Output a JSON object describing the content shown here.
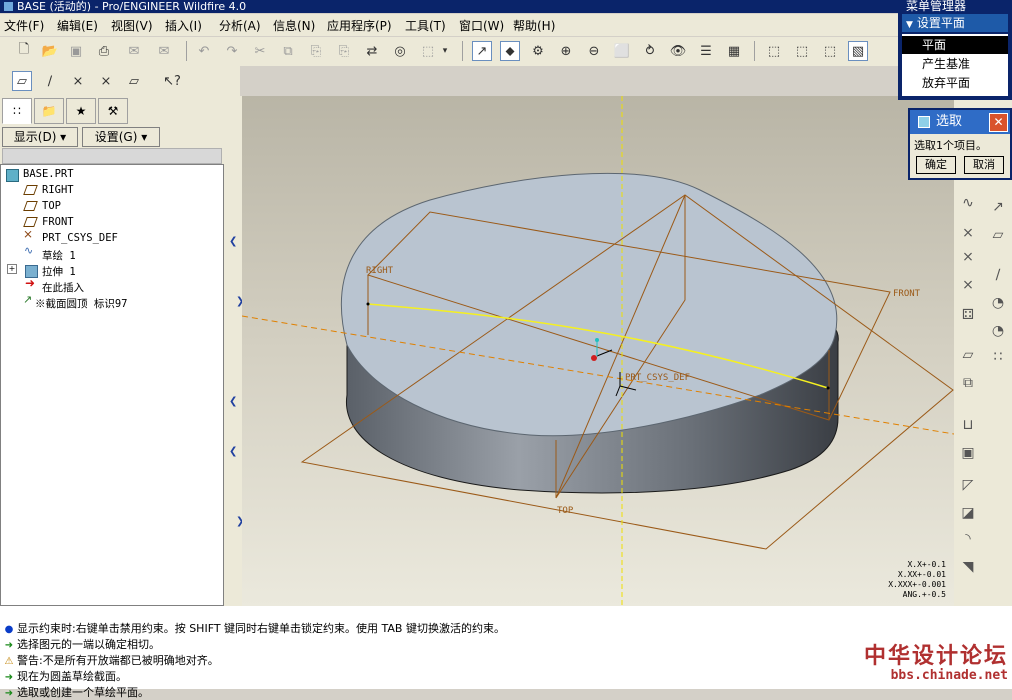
{
  "app": {
    "title": "BASE (活动的) - Pro/ENGINEER Wildfire 4.0"
  },
  "menubar": [
    "文件(F)",
    "编辑(E)",
    "视图(V)",
    "插入(I)",
    "分析(A)",
    "信息(N)",
    "应用程序(P)",
    "工具(T)",
    "窗口(W)",
    "帮助(H)"
  ],
  "sidebar": {
    "show_menu": "显示(D) ▾",
    "settings_menu": "设置(G) ▾",
    "tree": [
      {
        "label": "BASE.PRT",
        "icon": "part-icon"
      },
      {
        "label": "RIGHT",
        "icon": "datum-plane-icon"
      },
      {
        "label": "TOP",
        "icon": "datum-plane-icon"
      },
      {
        "label": "FRONT",
        "icon": "datum-plane-icon"
      },
      {
        "label": "PRT_CSYS_DEF",
        "icon": "coordinate-system-icon"
      },
      {
        "label": "草绘 1",
        "icon": "sketch-icon"
      },
      {
        "label": "拉伸 1",
        "icon": "extrude-icon"
      },
      {
        "label": "在此插入",
        "icon": "insert-here-arrow-icon"
      },
      {
        "label": "※截面圆顶 标识97",
        "icon": "section-dome-icon"
      }
    ]
  },
  "viewport": {
    "labels": {
      "right": "RIGHT",
      "front": "FRONT",
      "top": "TOP",
      "csys": "PRT_CSYS_DEF"
    },
    "tolerance": [
      "X.X+-0.1",
      "X.XX+-0.01",
      "X.XXX+-0.001",
      "ANG.+-0.5"
    ]
  },
  "menu_manager": {
    "title": "菜单管理器",
    "header": "设置平面",
    "items": [
      "平面",
      "产生基准",
      "放弃平面"
    ],
    "selected": "平面"
  },
  "select_dialog": {
    "title": "选取",
    "prompt": "选取1个项目。",
    "ok": "确定",
    "cancel": "取消"
  },
  "messages": [
    {
      "kind": "info",
      "text": "显示约束时:右键单击禁用约束。按 SHIFT 键同时右键单击锁定约束。使用 TAB 键切换激活的约束。"
    },
    {
      "kind": "prompt",
      "text": "选择图元的一端以确定相切。"
    },
    {
      "kind": "warning",
      "text": "警告:不是所有开放端都已被明确地对齐。"
    },
    {
      "kind": "prompt",
      "text": "现在为圆盖草绘截面。"
    },
    {
      "kind": "prompt",
      "text": "选取或创建一个草绘平面。"
    }
  ],
  "watermark": {
    "line1": "中华设计论坛",
    "line2": "bbs.chinade.net"
  }
}
